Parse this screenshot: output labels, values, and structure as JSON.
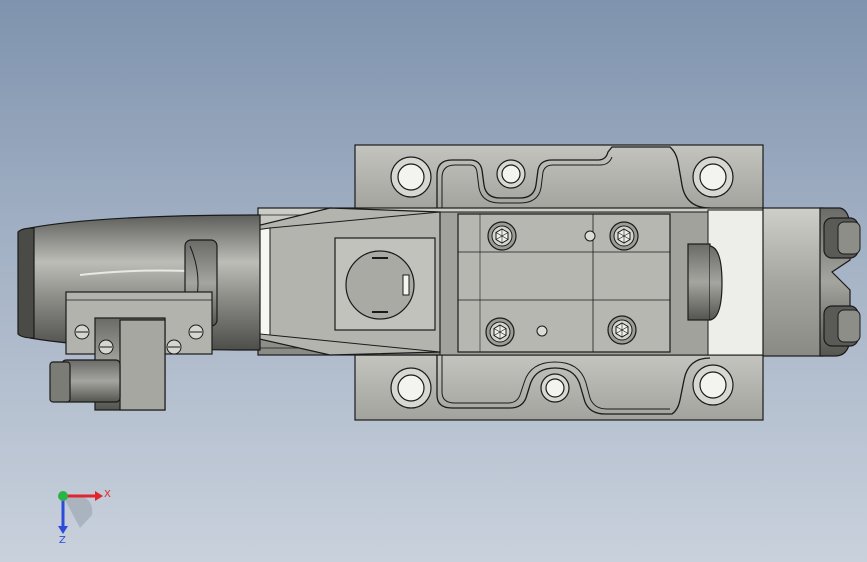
{
  "viewport": {
    "background_top": "#7f93ae",
    "background_bottom": "#c9d1dc",
    "model_colors": {
      "body": "#a9a9a5",
      "body_light": "#c9c9c4",
      "body_dark": "#6e6e6a",
      "outline": "#1a1a1a",
      "highlight": "#f1f1ee"
    }
  },
  "triad": {
    "x_label": "X",
    "z_label": "Z",
    "x_color": "#e0262b",
    "y_color": "#2bb34a",
    "z_color": "#2c4bd8"
  }
}
